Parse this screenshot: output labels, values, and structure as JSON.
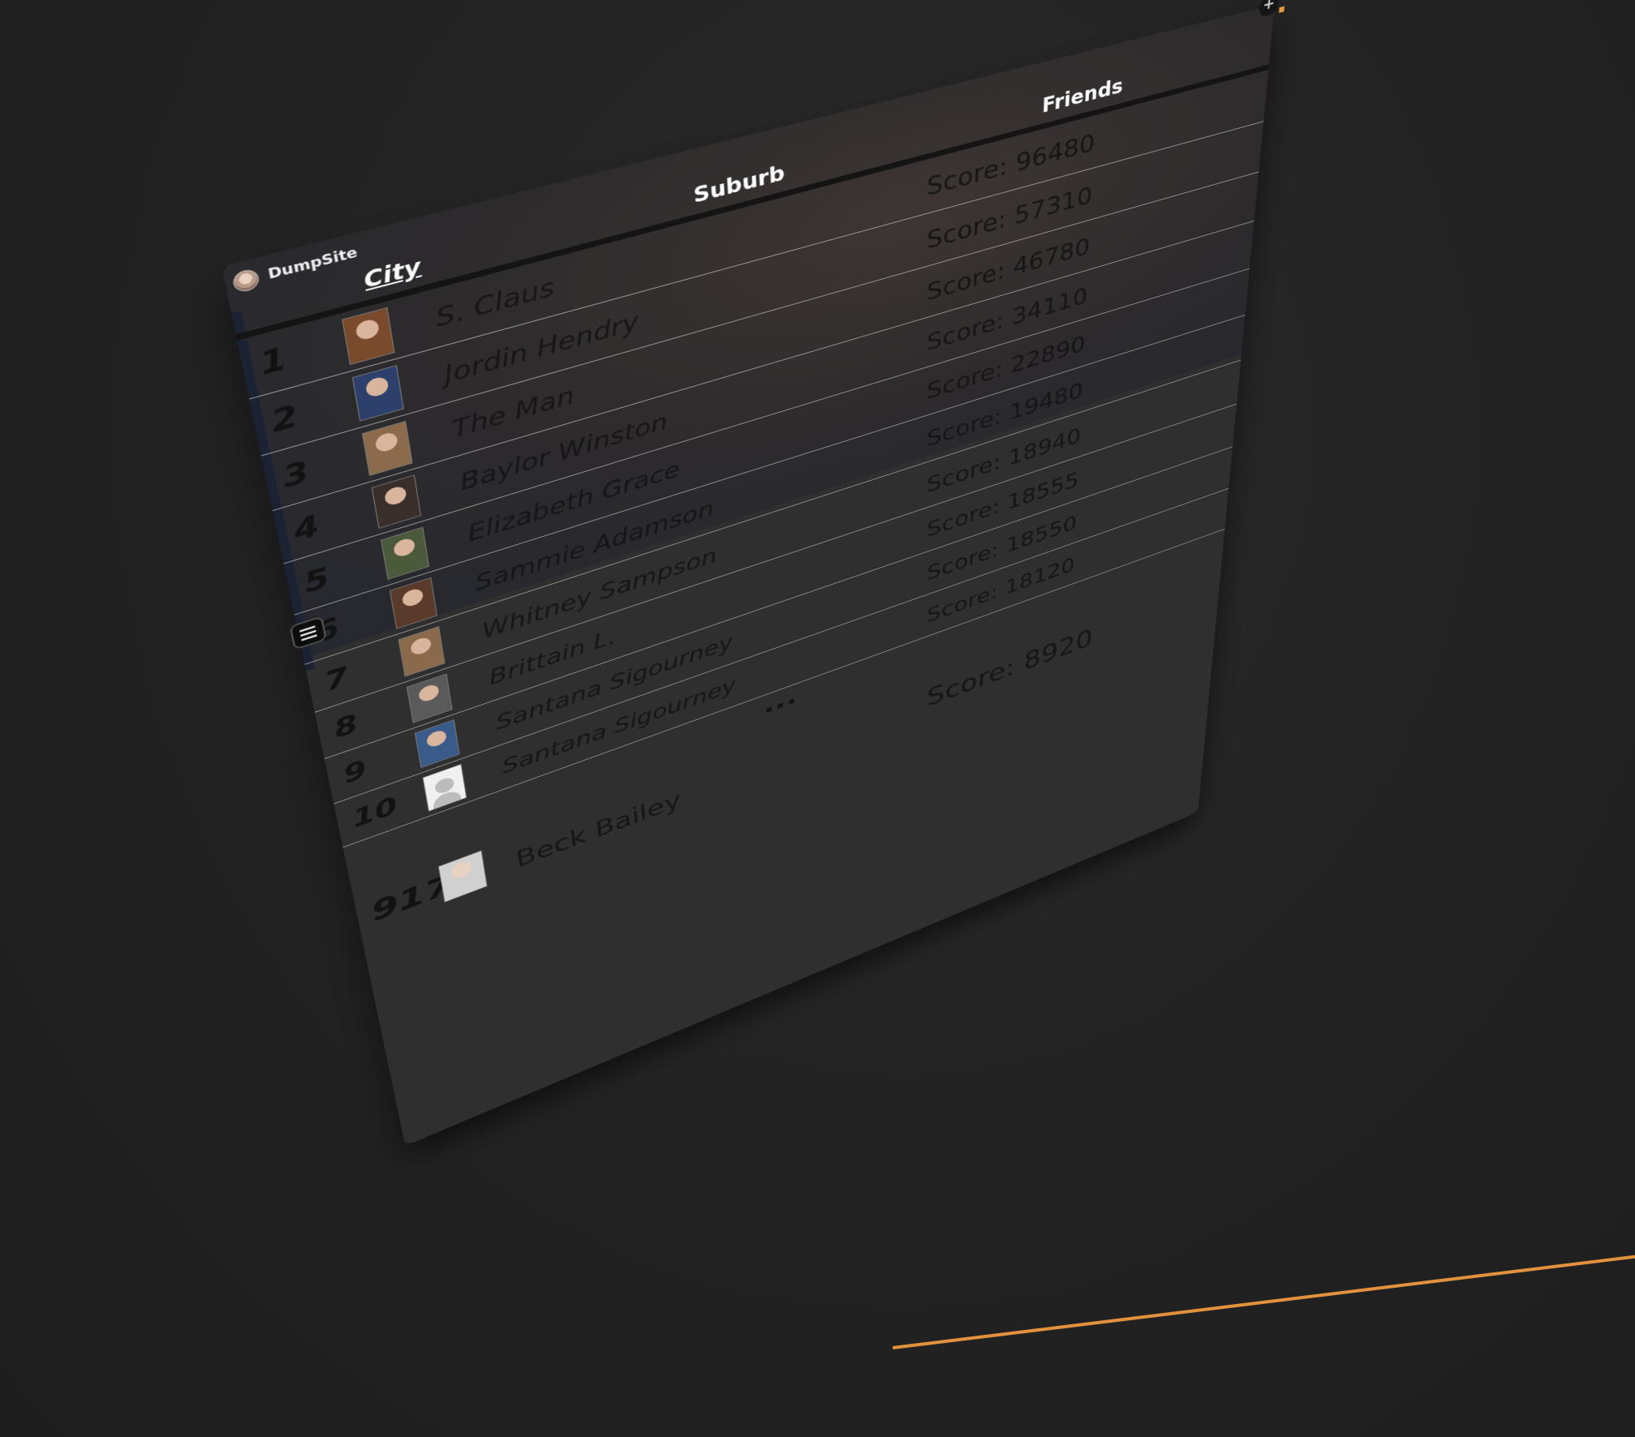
{
  "app": {
    "brand_name": "DumpSite",
    "accent_color": "#e89a3c"
  },
  "header": {
    "columns": [
      "City",
      "Suburb",
      "Friends"
    ],
    "active_column": "City"
  },
  "leaderboard": {
    "rows": [
      {
        "rank": "1",
        "name": "S. Claus",
        "score": "Score: 96480",
        "avatar": "photo"
      },
      {
        "rank": "2",
        "name": "Jordin Hendry",
        "score": "Score: 57310",
        "avatar": "photo"
      },
      {
        "rank": "3",
        "name": "The Man",
        "score": "Score: 46780",
        "avatar": "photo"
      },
      {
        "rank": "4",
        "name": "Baylor Winston",
        "score": "Score: 34110",
        "avatar": "photo"
      },
      {
        "rank": "5",
        "name": "Elizabeth Grace",
        "score": "Score: 22890",
        "avatar": "photo"
      },
      {
        "rank": "6",
        "name": "Sammie Adamson",
        "score": "Score: 19480",
        "avatar": "photo"
      },
      {
        "rank": "7",
        "name": "Whitney Sampson",
        "score": "Score: 18940",
        "avatar": "photo"
      },
      {
        "rank": "8",
        "name": "Brittain L.",
        "score": "Score: 18555",
        "avatar": "photo"
      },
      {
        "rank": "9",
        "name": "Santana Sigourney",
        "score": "Score: 18550",
        "avatar": "photo"
      },
      {
        "rank": "10",
        "name": "Santana Sigourney",
        "score": "Score: 18120",
        "avatar": "default"
      }
    ],
    "ellipsis": "...",
    "current_user": {
      "rank": "917",
      "name": "Beck Bailey",
      "score": "Score: 8920",
      "avatar": "photo"
    }
  },
  "icons": {
    "menu": "hamburger-icon",
    "add": "plus-icon"
  }
}
